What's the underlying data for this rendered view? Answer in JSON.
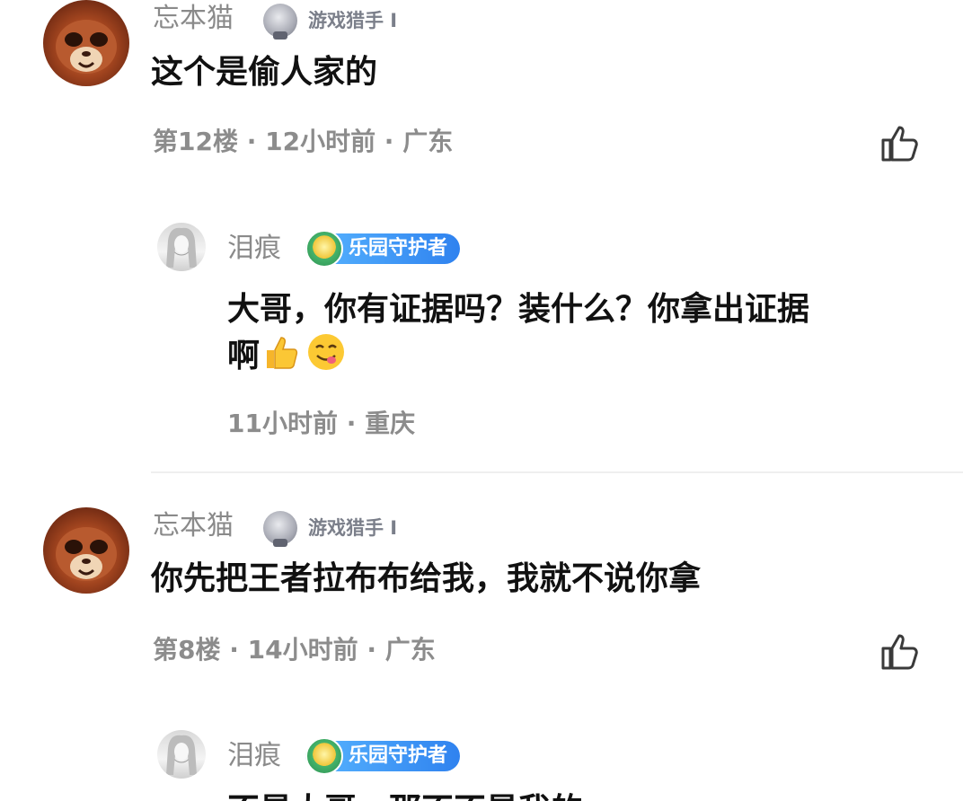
{
  "comments": [
    {
      "author": "忘本猫",
      "badge_label": "游戏猎手 I",
      "text": "这个是偷人家的",
      "meta": "第12楼 · 12小时前 · 广东"
    },
    {
      "author": "忘本猫",
      "badge_label": "游戏猎手 I",
      "text": "你先把王者拉布布给我，我就不说你拿",
      "meta": "第8楼 · 14小时前 · 广东"
    }
  ],
  "replies": [
    {
      "author": "泪痕",
      "badge_label": "乐园守护者",
      "text_line1": "大哥，你有证据吗？装什么？你拿出证据",
      "text_line2": "啊",
      "meta": "11小时前 · 重庆"
    },
    {
      "author": "泪痕",
      "badge_label": "乐园守护者",
      "text_partial": "不是大哥，那不不是我的"
    }
  ],
  "icons": {
    "like": "thumbs-up-outline-icon",
    "emoji_thumbs": "thumbs-up-emoji-icon",
    "emoji_yum": "yum-face-emoji-icon"
  },
  "colors": {
    "meta_text": "#8c8c8c",
    "badge_pill_start": "#58b5ff",
    "badge_pill_end": "#2f82ef"
  }
}
